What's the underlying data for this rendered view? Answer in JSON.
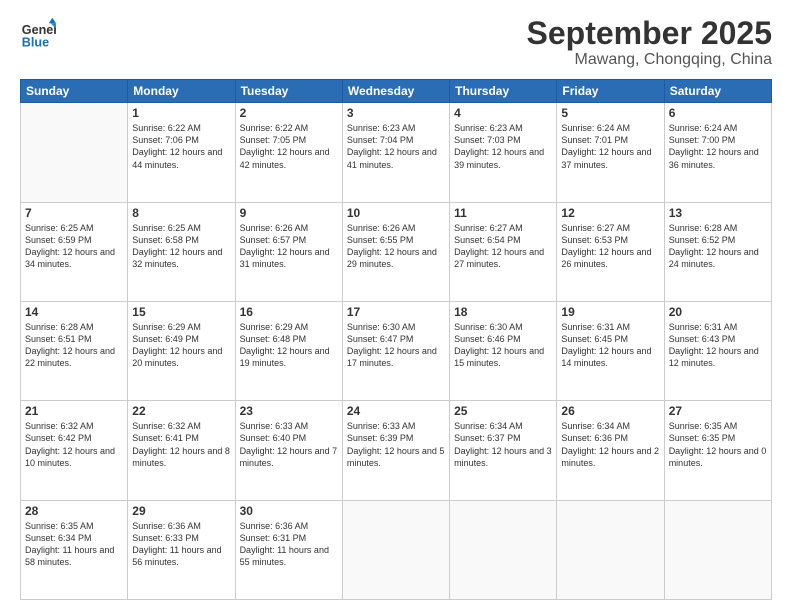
{
  "header": {
    "logo_line1": "General",
    "logo_line2": "Blue",
    "month": "September 2025",
    "location": "Mawang, Chongqing, China"
  },
  "days_of_week": [
    "Sunday",
    "Monday",
    "Tuesday",
    "Wednesday",
    "Thursday",
    "Friday",
    "Saturday"
  ],
  "weeks": [
    [
      {
        "day": "",
        "sunrise": "",
        "sunset": "",
        "daylight": ""
      },
      {
        "day": "1",
        "sunrise": "Sunrise: 6:22 AM",
        "sunset": "Sunset: 7:06 PM",
        "daylight": "Daylight: 12 hours and 44 minutes."
      },
      {
        "day": "2",
        "sunrise": "Sunrise: 6:22 AM",
        "sunset": "Sunset: 7:05 PM",
        "daylight": "Daylight: 12 hours and 42 minutes."
      },
      {
        "day": "3",
        "sunrise": "Sunrise: 6:23 AM",
        "sunset": "Sunset: 7:04 PM",
        "daylight": "Daylight: 12 hours and 41 minutes."
      },
      {
        "day": "4",
        "sunrise": "Sunrise: 6:23 AM",
        "sunset": "Sunset: 7:03 PM",
        "daylight": "Daylight: 12 hours and 39 minutes."
      },
      {
        "day": "5",
        "sunrise": "Sunrise: 6:24 AM",
        "sunset": "Sunset: 7:01 PM",
        "daylight": "Daylight: 12 hours and 37 minutes."
      },
      {
        "day": "6",
        "sunrise": "Sunrise: 6:24 AM",
        "sunset": "Sunset: 7:00 PM",
        "daylight": "Daylight: 12 hours and 36 minutes."
      }
    ],
    [
      {
        "day": "7",
        "sunrise": "Sunrise: 6:25 AM",
        "sunset": "Sunset: 6:59 PM",
        "daylight": "Daylight: 12 hours and 34 minutes."
      },
      {
        "day": "8",
        "sunrise": "Sunrise: 6:25 AM",
        "sunset": "Sunset: 6:58 PM",
        "daylight": "Daylight: 12 hours and 32 minutes."
      },
      {
        "day": "9",
        "sunrise": "Sunrise: 6:26 AM",
        "sunset": "Sunset: 6:57 PM",
        "daylight": "Daylight: 12 hours and 31 minutes."
      },
      {
        "day": "10",
        "sunrise": "Sunrise: 6:26 AM",
        "sunset": "Sunset: 6:55 PM",
        "daylight": "Daylight: 12 hours and 29 minutes."
      },
      {
        "day": "11",
        "sunrise": "Sunrise: 6:27 AM",
        "sunset": "Sunset: 6:54 PM",
        "daylight": "Daylight: 12 hours and 27 minutes."
      },
      {
        "day": "12",
        "sunrise": "Sunrise: 6:27 AM",
        "sunset": "Sunset: 6:53 PM",
        "daylight": "Daylight: 12 hours and 26 minutes."
      },
      {
        "day": "13",
        "sunrise": "Sunrise: 6:28 AM",
        "sunset": "Sunset: 6:52 PM",
        "daylight": "Daylight: 12 hours and 24 minutes."
      }
    ],
    [
      {
        "day": "14",
        "sunrise": "Sunrise: 6:28 AM",
        "sunset": "Sunset: 6:51 PM",
        "daylight": "Daylight: 12 hours and 22 minutes."
      },
      {
        "day": "15",
        "sunrise": "Sunrise: 6:29 AM",
        "sunset": "Sunset: 6:49 PM",
        "daylight": "Daylight: 12 hours and 20 minutes."
      },
      {
        "day": "16",
        "sunrise": "Sunrise: 6:29 AM",
        "sunset": "Sunset: 6:48 PM",
        "daylight": "Daylight: 12 hours and 19 minutes."
      },
      {
        "day": "17",
        "sunrise": "Sunrise: 6:30 AM",
        "sunset": "Sunset: 6:47 PM",
        "daylight": "Daylight: 12 hours and 17 minutes."
      },
      {
        "day": "18",
        "sunrise": "Sunrise: 6:30 AM",
        "sunset": "Sunset: 6:46 PM",
        "daylight": "Daylight: 12 hours and 15 minutes."
      },
      {
        "day": "19",
        "sunrise": "Sunrise: 6:31 AM",
        "sunset": "Sunset: 6:45 PM",
        "daylight": "Daylight: 12 hours and 14 minutes."
      },
      {
        "day": "20",
        "sunrise": "Sunrise: 6:31 AM",
        "sunset": "Sunset: 6:43 PM",
        "daylight": "Daylight: 12 hours and 12 minutes."
      }
    ],
    [
      {
        "day": "21",
        "sunrise": "Sunrise: 6:32 AM",
        "sunset": "Sunset: 6:42 PM",
        "daylight": "Daylight: 12 hours and 10 minutes."
      },
      {
        "day": "22",
        "sunrise": "Sunrise: 6:32 AM",
        "sunset": "Sunset: 6:41 PM",
        "daylight": "Daylight: 12 hours and 8 minutes."
      },
      {
        "day": "23",
        "sunrise": "Sunrise: 6:33 AM",
        "sunset": "Sunset: 6:40 PM",
        "daylight": "Daylight: 12 hours and 7 minutes."
      },
      {
        "day": "24",
        "sunrise": "Sunrise: 6:33 AM",
        "sunset": "Sunset: 6:39 PM",
        "daylight": "Daylight: 12 hours and 5 minutes."
      },
      {
        "day": "25",
        "sunrise": "Sunrise: 6:34 AM",
        "sunset": "Sunset: 6:37 PM",
        "daylight": "Daylight: 12 hours and 3 minutes."
      },
      {
        "day": "26",
        "sunrise": "Sunrise: 6:34 AM",
        "sunset": "Sunset: 6:36 PM",
        "daylight": "Daylight: 12 hours and 2 minutes."
      },
      {
        "day": "27",
        "sunrise": "Sunrise: 6:35 AM",
        "sunset": "Sunset: 6:35 PM",
        "daylight": "Daylight: 12 hours and 0 minutes."
      }
    ],
    [
      {
        "day": "28",
        "sunrise": "Sunrise: 6:35 AM",
        "sunset": "Sunset: 6:34 PM",
        "daylight": "Daylight: 11 hours and 58 minutes."
      },
      {
        "day": "29",
        "sunrise": "Sunrise: 6:36 AM",
        "sunset": "Sunset: 6:33 PM",
        "daylight": "Daylight: 11 hours and 56 minutes."
      },
      {
        "day": "30",
        "sunrise": "Sunrise: 6:36 AM",
        "sunset": "Sunset: 6:31 PM",
        "daylight": "Daylight: 11 hours and 55 minutes."
      },
      {
        "day": "",
        "sunrise": "",
        "sunset": "",
        "daylight": ""
      },
      {
        "day": "",
        "sunrise": "",
        "sunset": "",
        "daylight": ""
      },
      {
        "day": "",
        "sunrise": "",
        "sunset": "",
        "daylight": ""
      },
      {
        "day": "",
        "sunrise": "",
        "sunset": "",
        "daylight": ""
      }
    ]
  ]
}
